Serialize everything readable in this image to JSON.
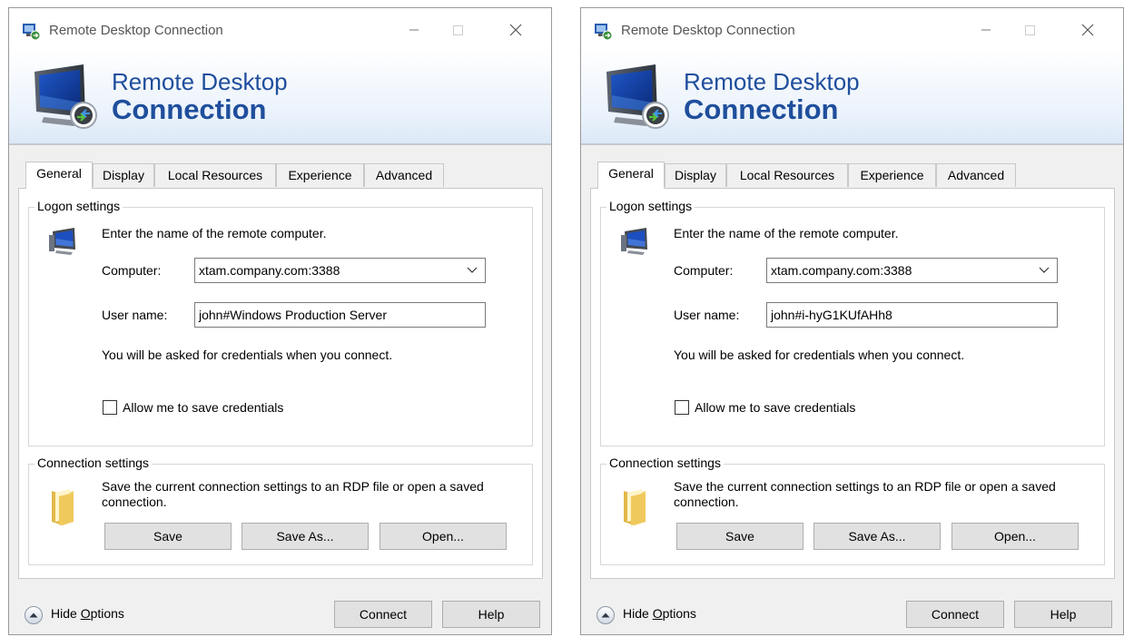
{
  "windows": [
    {
      "title": "Remote Desktop Connection",
      "banner": {
        "line1": "Remote Desktop",
        "line2": "Connection"
      },
      "tabs": [
        {
          "label": "General",
          "active": true
        },
        {
          "label": "Display",
          "active": false
        },
        {
          "label": "Local Resources",
          "active": false
        },
        {
          "label": "Experience",
          "active": false
        },
        {
          "label": "Advanced",
          "active": false
        }
      ],
      "logon": {
        "group_label": "Logon settings",
        "instruction": "Enter the name of the remote computer.",
        "computer_label": "Computer:",
        "computer_value": "xtam.company.com:3388",
        "user_label": "User name:",
        "user_value": "john#Windows Production Server",
        "note": "You will be asked for credentials when you connect.",
        "save_creds_label": "Allow me to save credentials",
        "save_creds_checked": false
      },
      "connection": {
        "group_label": "Connection settings",
        "description": "Save the current connection settings to an RDP file or open a saved connection.",
        "save": "Save",
        "save_as": "Save As...",
        "open": "Open..."
      },
      "footer": {
        "hide_options_prefix": "Hide ",
        "hide_options_underlined": "O",
        "hide_options_suffix": "ptions",
        "connect": "Connect",
        "help": "Help"
      }
    },
    {
      "title": "Remote Desktop Connection",
      "banner": {
        "line1": "Remote Desktop",
        "line2": "Connection"
      },
      "tabs": [
        {
          "label": "General",
          "active": true
        },
        {
          "label": "Display",
          "active": false
        },
        {
          "label": "Local Resources",
          "active": false
        },
        {
          "label": "Experience",
          "active": false
        },
        {
          "label": "Advanced",
          "active": false
        }
      ],
      "logon": {
        "group_label": "Logon settings",
        "instruction": "Enter the name of the remote computer.",
        "computer_label": "Computer:",
        "computer_value": "xtam.company.com:3388",
        "user_label": "User name:",
        "user_value": "john#i-hyG1KUfAHh8",
        "note": "You will be asked for credentials when you connect.",
        "save_creds_label": "Allow me to save credentials",
        "save_creds_checked": false
      },
      "connection": {
        "group_label": "Connection settings",
        "description": "Save the current connection settings to an RDP file or open a saved connection.",
        "save": "Save",
        "save_as": "Save As...",
        "open": "Open..."
      },
      "footer": {
        "hide_options_prefix": "Hide ",
        "hide_options_underlined": "O",
        "hide_options_suffix": "ptions",
        "connect": "Connect",
        "help": "Help"
      }
    }
  ],
  "colors": {
    "banner_text": "#1f4e9c",
    "window_bg": "#f0f0f0",
    "button_bg": "#e1e1e1"
  },
  "icons": {
    "app": "rdp-app-icon",
    "banner": "rdp-monitor-icon",
    "logon": "computer-icon",
    "connection": "folder-icon",
    "hide_options": "chevron-up-circle-icon"
  }
}
